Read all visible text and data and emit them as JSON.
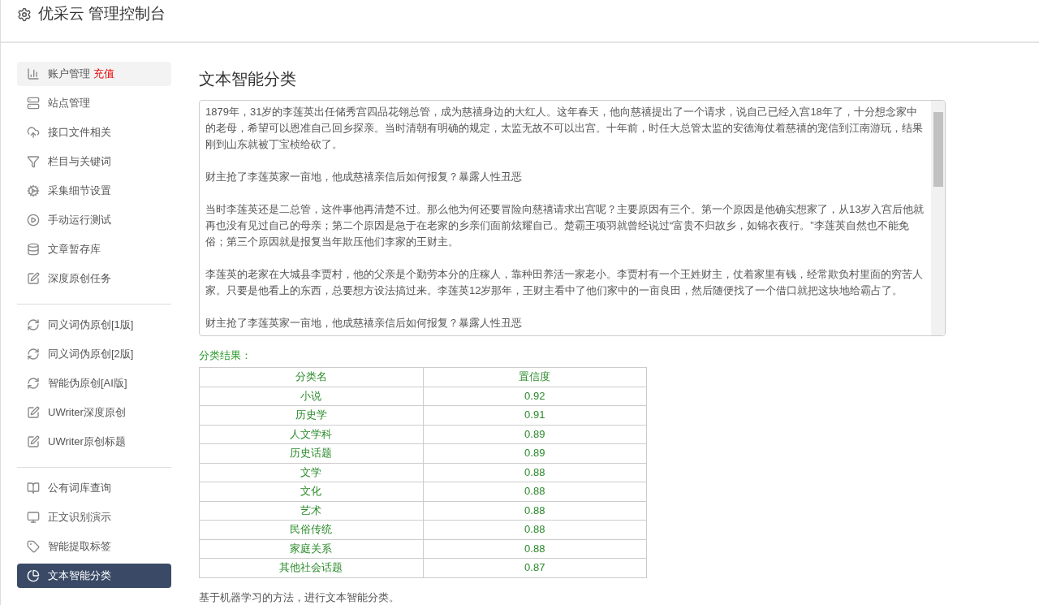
{
  "header": {
    "title": "优采云 管理控制台"
  },
  "sidebar": {
    "groups": [
      [
        {
          "label": "账户管理",
          "badge": "充值",
          "selected": false,
          "highlighted": true
        },
        {
          "label": "站点管理",
          "selected": false,
          "highlighted": false
        },
        {
          "label": "接口文件相关",
          "selected": false,
          "highlighted": false
        },
        {
          "label": "栏目与关键词",
          "selected": false,
          "highlighted": false
        },
        {
          "label": "采集细节设置",
          "selected": false,
          "highlighted": false
        },
        {
          "label": "手动运行测试",
          "selected": false,
          "highlighted": false
        },
        {
          "label": "文章暂存库",
          "selected": false,
          "highlighted": false
        },
        {
          "label": "深度原创任务",
          "selected": false,
          "highlighted": false
        }
      ],
      [
        {
          "label": "同义词伪原创[1版]",
          "selected": false,
          "highlighted": false
        },
        {
          "label": "同义词伪原创[2版]",
          "selected": false,
          "highlighted": false
        },
        {
          "label": "智能伪原创[AI版]",
          "selected": false,
          "highlighted": false
        },
        {
          "label": "UWriter深度原创",
          "selected": false,
          "highlighted": false
        },
        {
          "label": "UWriter原创标题",
          "selected": false,
          "highlighted": false
        }
      ],
      [
        {
          "label": "公有词库查询",
          "selected": false,
          "highlighted": false
        },
        {
          "label": "正文识别演示",
          "selected": false,
          "highlighted": false
        },
        {
          "label": "智能提取标签",
          "selected": false,
          "highlighted": false
        },
        {
          "label": "文本智能分类",
          "selected": true
        }
      ]
    ]
  },
  "main": {
    "title": "文本智能分类",
    "text_area": {
      "paragraphs": [
        "1879年，31岁的李莲英出任储秀宫四品花翎总管，成为慈禧身边的大红人。这年春天，他向慈禧提出了一个请求，说自己已经入宫18年了，十分想念家中的老母，希望可以恩准自己回乡探亲。当时清朝有明确的规定，太监无故不可以出宫。十年前，时任大总管太监的安德海仗着慈禧的宠信到江南游玩，结果刚到山东就被丁宝桢给砍了。",
        "财主抢了李莲英家一亩地，他成慈禧亲信后如何报复？暴露人性丑恶",
        "当时李莲英还是二总管，这件事他再清楚不过。那么他为何还要冒险向慈禧请求出宫呢？主要原因有三个。第一个原因是他确实想家了，从13岁入宫后他就再也没有见过自己的母亲；第二个原因是急于在老家的乡亲们面前炫耀自己。楚霸王项羽就曾经说过“富贵不归故乡，如锦衣夜行。”李莲英自然也不能免俗；第三个原因就是报复当年欺压他们李家的王财主。",
        "李莲英的老家在大城县李贾村，他的父亲是个勤劳本分的庄稼人，靠种田养活一家老小。李贾村有一个王姓财主，仗着家里有钱，经常欺负村里面的穷苦人家。只要是他看上的东西，总要想方设法搞过来。李莲英12岁那年，王财主看中了他们家中的一亩良田，然后随便找了一个借口就把这块地给霸占了。",
        "财主抢了李莲英家一亩地，他成慈禧亲信后如何报复？暴露人性丑恶"
      ]
    },
    "result_label": "分类结果：",
    "table": {
      "columns": [
        "分类名",
        "置信度"
      ],
      "rows": [
        [
          "小说",
          "0.92"
        ],
        [
          "历史学",
          "0.91"
        ],
        [
          "人文学科",
          "0.89"
        ],
        [
          "历史话题",
          "0.89"
        ],
        [
          "文学",
          "0.88"
        ],
        [
          "文化",
          "0.88"
        ],
        [
          "艺术",
          "0.88"
        ],
        [
          "民俗传统",
          "0.88"
        ],
        [
          "家庭关系",
          "0.88"
        ],
        [
          "其他社会话题",
          "0.87"
        ]
      ]
    },
    "description": "基于机器学习的方法，进行文本智能分类。"
  }
}
